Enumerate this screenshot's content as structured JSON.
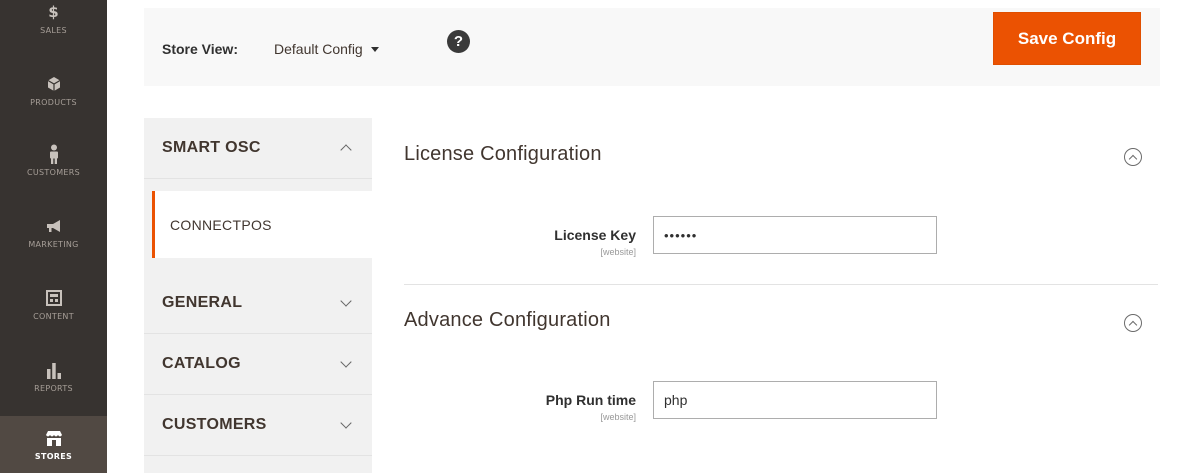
{
  "admin_menu": {
    "items": [
      {
        "label": "Sales",
        "icon": "dollar-icon",
        "glyph": "$"
      },
      {
        "label": "Products",
        "icon": "cube-icon",
        "glyph": "⬢"
      },
      {
        "label": "Customers",
        "icon": "person-icon",
        "glyph": "♟"
      },
      {
        "label": "Marketing",
        "icon": "megaphone-icon",
        "glyph": "📢"
      },
      {
        "label": "Content",
        "icon": "layout-icon",
        "glyph": "▤"
      },
      {
        "label": "Reports",
        "icon": "bar-chart-icon",
        "glyph": "▮"
      },
      {
        "label": "Stores",
        "icon": "storefront-icon",
        "glyph": "⌂",
        "active": true
      }
    ]
  },
  "store_bar": {
    "label": "Store View:",
    "selected": "Default Config",
    "help_glyph": "?",
    "save_label": "Save Config"
  },
  "tabs": {
    "smart_osc": {
      "title": "SMART OSC",
      "expanded": true,
      "subitem": "CONNECTPOS"
    },
    "general": {
      "title": "GENERAL"
    },
    "catalog": {
      "title": "CATALOG"
    },
    "customers": {
      "title": "CUSTOMERS"
    }
  },
  "license_section": {
    "title": "License Configuration",
    "field_label": "License Key",
    "field_scope": "[website]",
    "field_value": "••••••"
  },
  "advance_section": {
    "title": "Advance Configuration",
    "field_label": "Php Run time",
    "field_scope": "[website]",
    "field_value": "php"
  },
  "colors": {
    "accent": "#eb5202",
    "menu_bg": "#373330",
    "menu_active": "#514943"
  }
}
